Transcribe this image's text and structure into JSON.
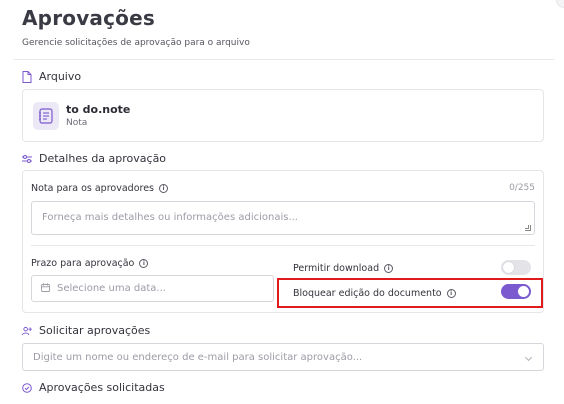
{
  "header": {
    "title": "Aprovações",
    "subtitle": "Gerencie solicitações de aprovação para o arquivo"
  },
  "file_section": {
    "title": "Arquivo",
    "icon": "file-icon",
    "file_name": "to do.note",
    "file_type": "Nota"
  },
  "details_section": {
    "title": "Detalhes da aprovação",
    "icon": "sliders-icon",
    "note_label": "Nota para os aprovadores",
    "note_counter": "0/255",
    "note_placeholder": "Forneça mais detalhes ou informações adicionais...",
    "deadline_label": "Prazo para aprovação",
    "deadline_placeholder": "Selecione uma data...",
    "allow_download_label": "Permitir download",
    "allow_download_on": false,
    "block_edit_label": "Bloquear edição do documento",
    "block_edit_on": true
  },
  "request_section": {
    "title": "Solicitar aprovações",
    "icon": "user-plus-icon",
    "input_placeholder": "Digite um nome ou endereço de e-mail para solicitar aprovação..."
  },
  "requested_section": {
    "title": "Aprovações solicitadas",
    "icon": "check-circle-icon"
  },
  "colors": {
    "accent": "#7b5ad0",
    "highlight": "#e01b1b"
  }
}
